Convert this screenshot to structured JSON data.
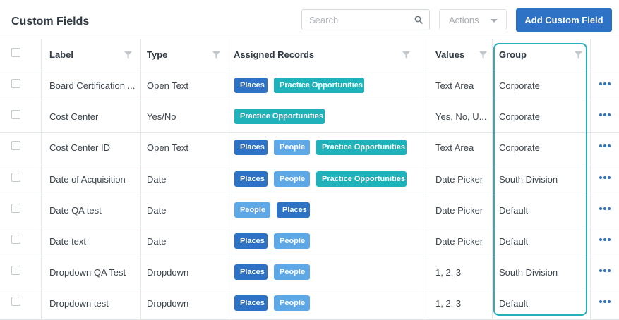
{
  "header": {
    "title": "Custom Fields",
    "search_placeholder": "Search",
    "actions_label": "Actions",
    "add_button_label": "Add Custom Field"
  },
  "columns": {
    "label": "Label",
    "type": "Type",
    "assigned_records": "Assigned Records",
    "values": "Values",
    "group": "Group"
  },
  "rows": [
    {
      "label": "Board Certification ...",
      "type": "Open Text",
      "tags": [
        "Places",
        "Practice Opportunities"
      ],
      "values": "Text Area",
      "group": "Corporate"
    },
    {
      "label": "Cost Center",
      "type": "Yes/No",
      "tags": [
        "Practice Opportunities"
      ],
      "values": "Yes, No, U...",
      "group": "Corporate"
    },
    {
      "label": "Cost Center ID",
      "type": "Open Text",
      "tags": [
        "Places",
        "People",
        "Practice Opportunities"
      ],
      "values": "Text Area",
      "group": "Corporate"
    },
    {
      "label": "Date of Acquisition",
      "type": "Date",
      "tags": [
        "Places",
        "People",
        "Practice Opportunities"
      ],
      "values": "Date Picker",
      "group": "South Division"
    },
    {
      "label": "Date QA test",
      "type": "Date",
      "tags": [
        "People",
        "Places"
      ],
      "values": "Date Picker",
      "group": "Default"
    },
    {
      "label": "Date text",
      "type": "Date",
      "tags": [
        "Places",
        "People"
      ],
      "values": "Date Picker",
      "group": "Default"
    },
    {
      "label": "Dropdown QA Test",
      "type": "Dropdown",
      "tags": [
        "Places",
        "People"
      ],
      "values": "1, 2, 3",
      "group": "South Division"
    },
    {
      "label": "Dropdown test",
      "type": "Dropdown",
      "tags": [
        "Places",
        "People"
      ],
      "values": "1, 2, 3",
      "group": "Default"
    }
  ],
  "icons": {
    "search": "search-icon",
    "filter": "filter-icon",
    "more": "more-options-icon",
    "dropdown": "chevron-down-icon"
  },
  "colors": {
    "primary": "#2d72c4",
    "places_tag": "#2d72c4",
    "people_tag": "#5fa8e8",
    "practice_tag": "#1fb2bb",
    "group_highlight": "#26b0bc"
  }
}
